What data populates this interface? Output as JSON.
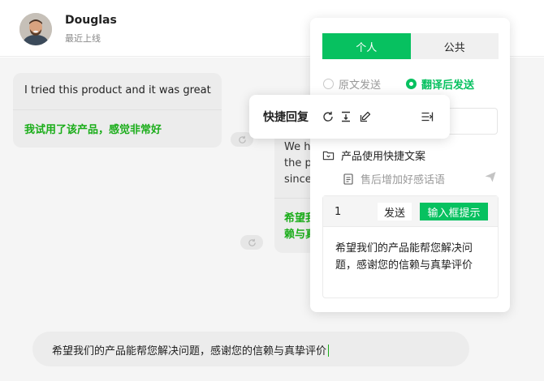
{
  "header": {
    "contact_name": "Douglas",
    "status": "最近上线"
  },
  "chat": {
    "incoming": {
      "original": "I tried this product and it was great",
      "translation": "我试用了该产品，感觉非常好"
    },
    "outgoing": {
      "lines": [
        "We h",
        "the p",
        "since"
      ],
      "translation_lines": [
        "希望我",
        "赖与真"
      ]
    }
  },
  "input": {
    "value": "希望我们的产品能帮您解决问题，感谢您的信赖与真挚评价"
  },
  "panel": {
    "tabs": [
      {
        "label": "个人",
        "active": true
      },
      {
        "label": "公共",
        "active": false
      }
    ],
    "send_modes": [
      {
        "label": "原文发送",
        "selected": false
      },
      {
        "label": "翻译后发送",
        "selected": true
      }
    ],
    "folder_label": "产品使用快捷文案",
    "item_label": "售后增加好感话语",
    "editor": {
      "number": "1",
      "send_label": "发送",
      "hint_label": "输入框提示",
      "content": "希望我们的产品能帮您解决问题，感谢您的信赖与真挚评价"
    }
  },
  "popover": {
    "title": "快捷回复"
  },
  "colors": {
    "accent": "#07c160",
    "translation_green": "#1aad19",
    "send_button": "#1f1f1f"
  }
}
